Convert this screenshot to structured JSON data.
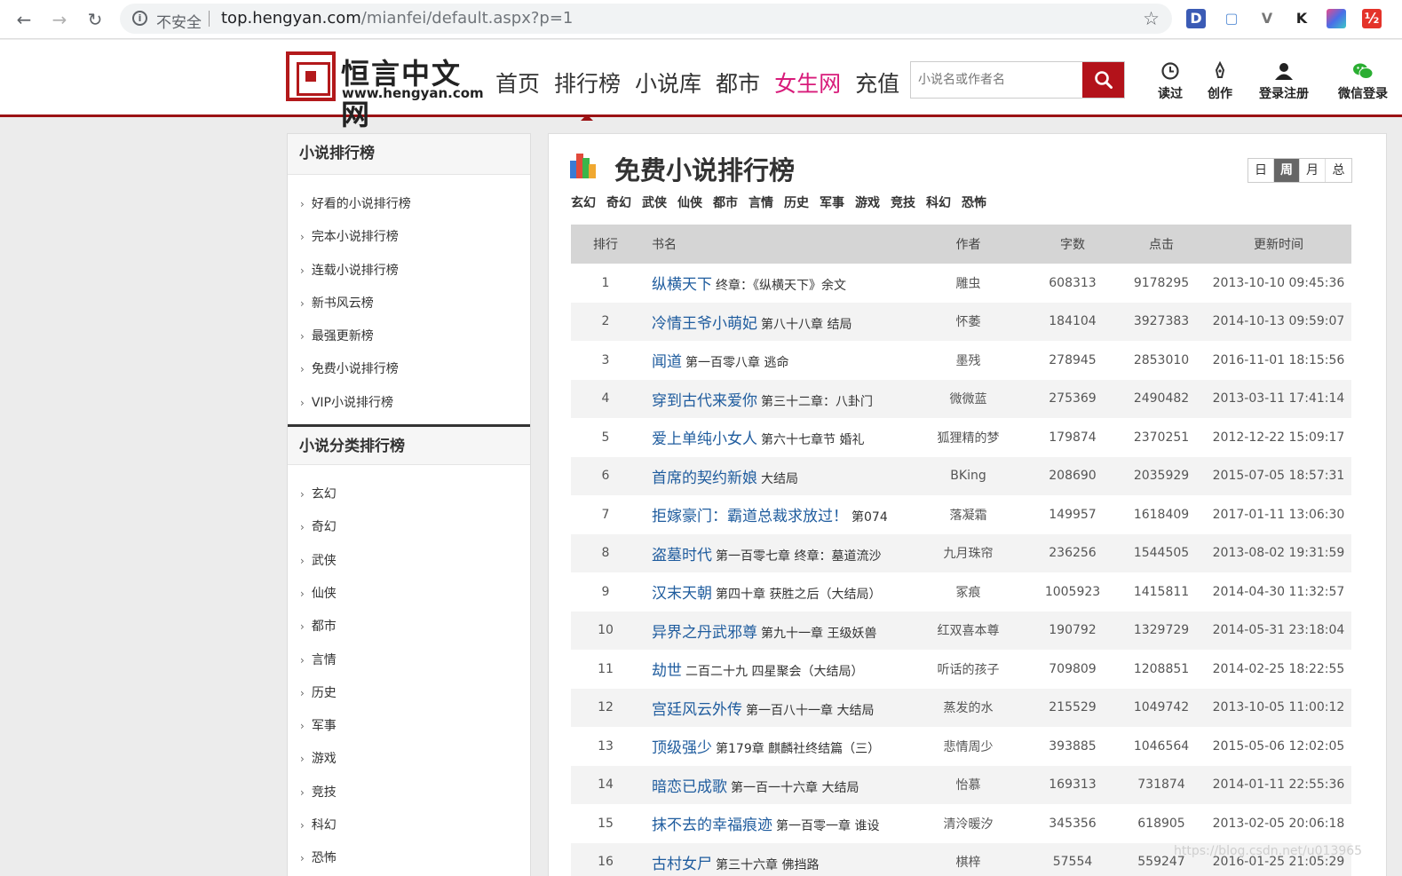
{
  "browser": {
    "back": "←",
    "forward": "→",
    "reload": "↻",
    "security_label": "不安全",
    "url_host": "top.hengyan.com",
    "url_path": "/mianfei/default.aspx?p=1",
    "extensions": [
      "D",
      "▢",
      "V",
      "K",
      "■",
      "½"
    ]
  },
  "site": {
    "logo_title": "恒言中文网",
    "logo_url": "www.hengyan.com",
    "nav": [
      "首页",
      "排行榜",
      "小说库",
      "都市",
      "女生网",
      "充值"
    ],
    "search_placeholder": "小说名或作者名",
    "tools": [
      {
        "icon": "clock-icon",
        "label": "读过"
      },
      {
        "icon": "pen-icon",
        "label": "创作"
      },
      {
        "icon": "user-icon",
        "label": "登录注册"
      },
      {
        "icon": "wechat-icon",
        "label": "微信登录"
      }
    ]
  },
  "sidebar": {
    "heading1": "小说排行榜",
    "items1": [
      "好看的小说排行榜",
      "完本小说排行榜",
      "连载小说排行榜",
      "新书风云榜",
      "最强更新榜",
      "免费小说排行榜",
      "VIP小说排行榜"
    ],
    "heading2": "小说分类排行榜",
    "items2": [
      "玄幻",
      "奇幻",
      "武侠",
      "仙侠",
      "都市",
      "言情",
      "历史",
      "军事",
      "游戏",
      "竞技",
      "科幻",
      "恐怖"
    ]
  },
  "main": {
    "title": "免费小说排行榜",
    "periods": [
      "日",
      "周",
      "月",
      "总"
    ],
    "active_period": "周",
    "genres": [
      "玄幻",
      "奇幻",
      "武侠",
      "仙侠",
      "都市",
      "言情",
      "历史",
      "军事",
      "游戏",
      "竞技",
      "科幻",
      "恐怖"
    ],
    "columns": [
      "排行",
      "书名",
      "作者",
      "字数",
      "点击",
      "更新时间"
    ],
    "rows": [
      {
        "rank": "1",
        "name": "纵横天下",
        "chapter": "终章：《纵横天下》余文",
        "author": "雕虫",
        "words": "608313",
        "clicks": "9178295",
        "updated": "2013-10-10 09:45:36"
      },
      {
        "rank": "2",
        "name": "冷情王爷小萌妃",
        "chapter": "第八十八章 结局",
        "author": "怀萎",
        "words": "184104",
        "clicks": "3927383",
        "updated": "2014-10-13 09:59:07"
      },
      {
        "rank": "3",
        "name": "闻道",
        "chapter": "第一百零八章 逃命",
        "author": "墨残",
        "words": "278945",
        "clicks": "2853010",
        "updated": "2016-11-01 18:15:56"
      },
      {
        "rank": "4",
        "name": "穿到古代来爱你",
        "chapter": "第三十二章：八卦门",
        "author": "微微蓝",
        "words": "275369",
        "clicks": "2490482",
        "updated": "2013-03-11 17:41:14"
      },
      {
        "rank": "5",
        "name": "爱上单纯小女人",
        "chapter": "第六十七章节 婚礼",
        "author": "狐狸精的梦",
        "words": "179874",
        "clicks": "2370251",
        "updated": "2012-12-22 15:09:17"
      },
      {
        "rank": "6",
        "name": "首席的契约新娘",
        "chapter": "大结局",
        "author": "BKing",
        "words": "208690",
        "clicks": "2035929",
        "updated": "2015-07-05 18:57:31"
      },
      {
        "rank": "7",
        "name": "拒嫁豪门：霸道总裁求放过！",
        "chapter": "第074",
        "author": "落凝霜",
        "words": "149957",
        "clicks": "1618409",
        "updated": "2017-01-11 13:06:30"
      },
      {
        "rank": "8",
        "name": "盗墓时代",
        "chapter": "第一百零七章 终章：墓道流沙",
        "author": "九月珠帘",
        "words": "236256",
        "clicks": "1544505",
        "updated": "2013-08-02 19:31:59"
      },
      {
        "rank": "9",
        "name": "汉末天朝",
        "chapter": "第四十章 获胜之后（大结局）",
        "author": "冢痕",
        "words": "1005923",
        "clicks": "1415811",
        "updated": "2014-04-30 11:32:57"
      },
      {
        "rank": "10",
        "name": "异界之丹武邪尊",
        "chapter": "第九十一章 王级妖兽",
        "author": "红双喜本尊",
        "words": "190792",
        "clicks": "1329729",
        "updated": "2014-05-31 23:18:04"
      },
      {
        "rank": "11",
        "name": "劫世",
        "chapter": "二百二十九 四星聚会（大结局）",
        "author": "听话的孩子",
        "words": "709809",
        "clicks": "1208851",
        "updated": "2014-02-25 18:22:55"
      },
      {
        "rank": "12",
        "name": "宫廷风云外传",
        "chapter": "第一百八十一章 大结局",
        "author": "蒸发的水",
        "words": "215529",
        "clicks": "1049742",
        "updated": "2013-10-05 11:00:12"
      },
      {
        "rank": "13",
        "name": "顶级强少",
        "chapter": "第179章 麒麟社终结篇（三）",
        "author": "悲情周少",
        "words": "393885",
        "clicks": "1046564",
        "updated": "2015-05-06 12:02:05"
      },
      {
        "rank": "14",
        "name": "暗恋已成歌",
        "chapter": "第一百一十六章 大结局",
        "author": "怡慕",
        "words": "169313",
        "clicks": "731874",
        "updated": "2014-01-11 22:55:36"
      },
      {
        "rank": "15",
        "name": "抹不去的幸福痕迹",
        "chapter": "第一百零一章 谁设",
        "author": "清泠暖汐",
        "words": "345356",
        "clicks": "618905",
        "updated": "2013-02-05 20:06:18"
      },
      {
        "rank": "16",
        "name": "古村女尸",
        "chapter": "第三十六章 佛挡路",
        "author": "棋梓",
        "words": "57554",
        "clicks": "559247",
        "updated": "2016-01-25 21:05:29"
      }
    ]
  },
  "watermark": "https://blog.csdn.net/u013965"
}
